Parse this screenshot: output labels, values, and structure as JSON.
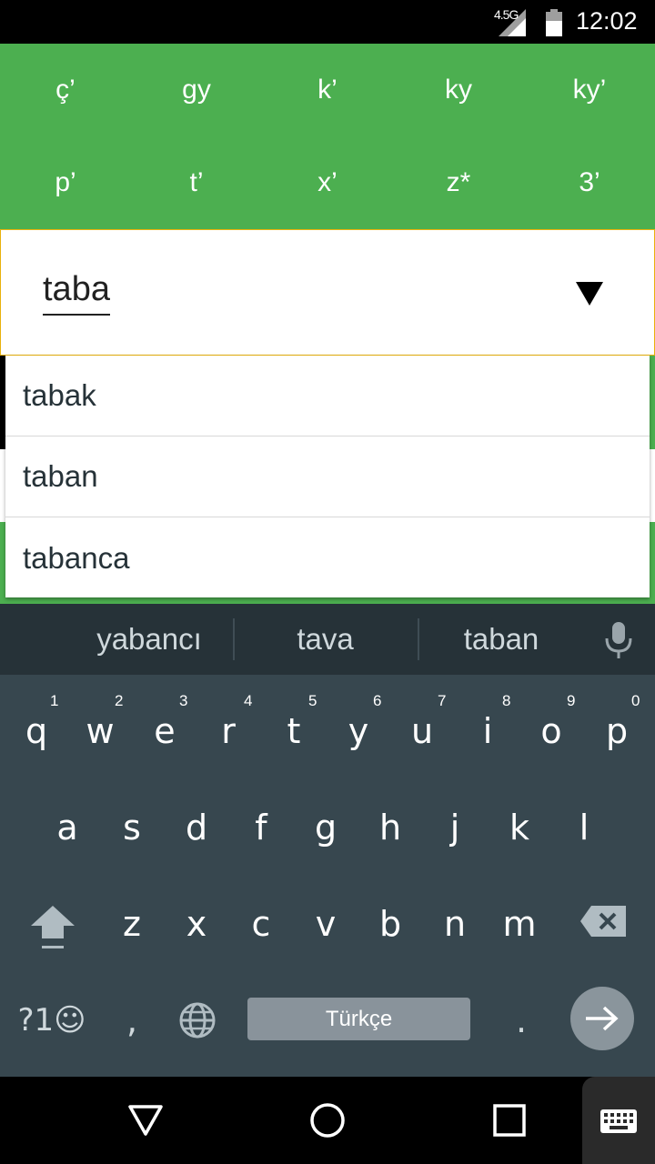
{
  "status_bar": {
    "network": "4.5G",
    "time": "12:02"
  },
  "char_panel": {
    "rows": [
      [
        "ç’",
        "gy",
        "k’",
        "ky",
        "ky’"
      ],
      [
        "p’",
        "t’",
        "x’",
        "z*",
        "3’"
      ]
    ]
  },
  "input": {
    "value": "taba"
  },
  "suggestions": [
    "tabak",
    "taban",
    "tabanca"
  ],
  "keyboard": {
    "strip": [
      "yabancı",
      "tava",
      "taban"
    ],
    "row1": [
      "q",
      "w",
      "e",
      "r",
      "t",
      "y",
      "u",
      "i",
      "o",
      "p"
    ],
    "row1_hints": [
      "",
      "1",
      "2",
      "3",
      "4",
      "5",
      "6",
      "7",
      "8",
      "9",
      "0"
    ],
    "row2": [
      "a",
      "s",
      "d",
      "f",
      "g",
      "h",
      "j",
      "k",
      "l"
    ],
    "row3": [
      "z",
      "x",
      "c",
      "v",
      "b",
      "n",
      "m"
    ],
    "symbols_label": "?1☺",
    "comma": ",",
    "space_label": "Türkçe",
    "period": "."
  },
  "colors": {
    "accent_green": "#4caf50",
    "keyboard_bg": "#37474f",
    "strip_bg": "#263238"
  }
}
